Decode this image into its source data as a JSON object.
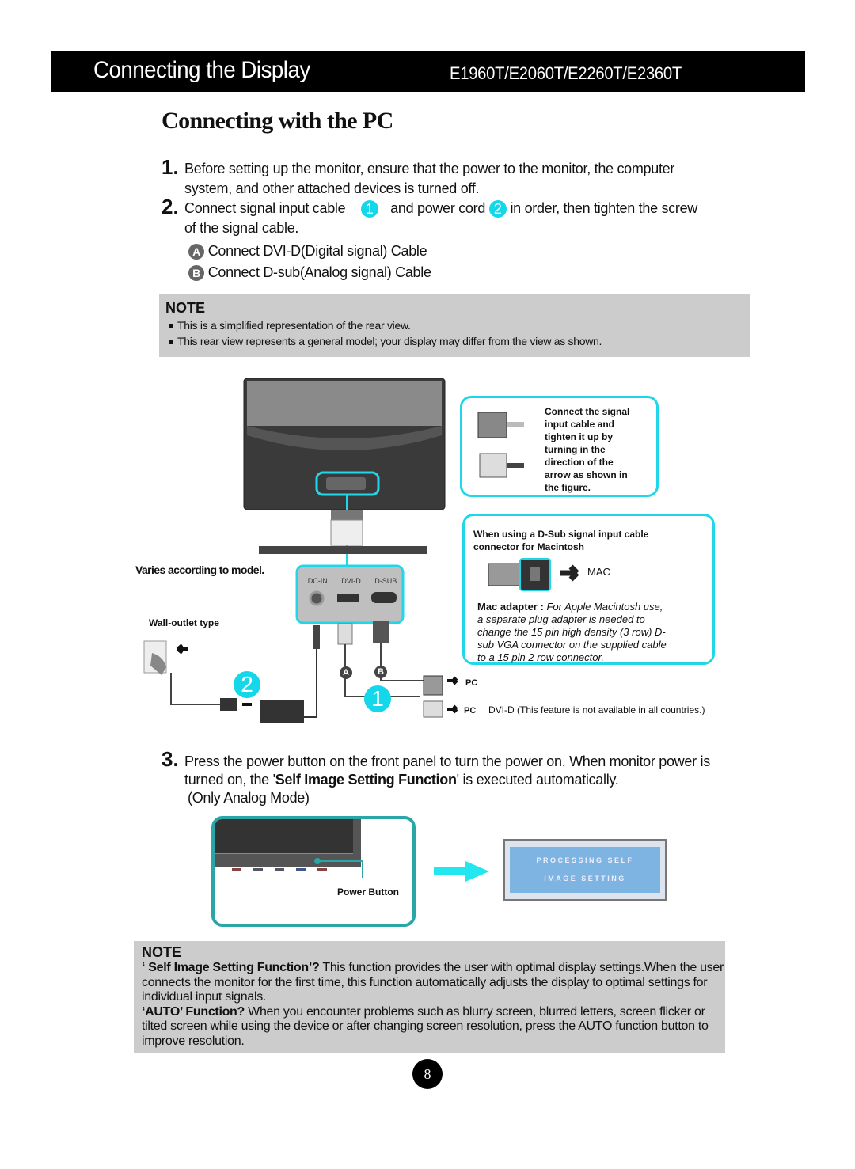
{
  "header": {
    "title": "Connecting the Display",
    "models": "E1960T/E2060T/E2260T/E2360T"
  },
  "section_title": "Connecting with the PC",
  "steps": {
    "s1": {
      "num": "1.",
      "line1": "Before setting up the monitor, ensure that the power to the monitor, the computer",
      "line2": "system, and other attached devices is turned off."
    },
    "s2": {
      "num": "2.",
      "part1": "Connect signal input cable",
      "badge1": "1",
      "part2": "and power cord",
      "badge2": "2",
      "part3": "in order, then tighten the screw",
      "line2": "of the signal cable."
    },
    "sub_a": {
      "badge": "A",
      "text": "Connect DVI-D(Digital signal) Cable"
    },
    "sub_b": {
      "badge": "B",
      "text": "Connect D-sub(Analog signal) Cable"
    },
    "s3": {
      "num": "3.",
      "line1": "Press the power button on the front panel to turn the power on. When monitor power is",
      "line2_pre": "turned on, the '",
      "line2_bold": "Self Image Setting Function",
      "line2_post": "' is executed automatically.",
      "line3": "(Only Analog Mode)"
    }
  },
  "note1": {
    "heading": "NOTE",
    "items": [
      "This is a simplified representation of the rear view.",
      "This rear view represents a general model; your display may differ from the view as shown."
    ]
  },
  "diagram": {
    "tighten_callout": "Connect the signal input cable and tighten it up by turning in the direction of the arrow as shown in the figure.",
    "tighten_lines": [
      "Connect the signal",
      "input cable and",
      "tighten it up by",
      "turning in the",
      "direction of the",
      "arrow as shown in",
      "the figure."
    ],
    "mac_heading": [
      "When using a D-Sub signal input cable",
      "connector for Macintosh"
    ],
    "mac_label": "MAC",
    "mac_adapter_bold": "Mac adapter :",
    "mac_adapter_lines": [
      "For Apple Macintosh use,",
      "a  separate plug adapter is needed to",
      "change the 15 pin high density (3 row) D-",
      "sub VGA connector on the supplied cable",
      "to a 15 pin  2 row connector."
    ],
    "varies": "Varies according to model.",
    "wall_outlet": "Wall-outlet type",
    "ports": [
      "DC-IN",
      "DVI-D",
      "D-SUB"
    ],
    "badge_a": "A",
    "badge_b": "B",
    "badge_1": "1",
    "badge_2": "2",
    "pc_label_1": "PC",
    "pc_label_2": "PC",
    "dvi_note": "DVI-D (This feature is not available in all countries.)",
    "power_button": "Power Button",
    "osd_line1": "PROCESSING SELF",
    "osd_line2": "IMAGE SETTING"
  },
  "note2": {
    "heading": "NOTE",
    "p1_bold": "‘ Self Image Setting Function’?",
    "p1_text": " This function provides the user with optimal display settings.When the user connects the monitor for the first time, this function automatically adjusts the display to optimal settings for individual input signals.",
    "p2_bold": "‘AUTO’ Function?",
    "p2_text": " When you encounter problems such as blurry screen, blurred letters, screen flicker or tilted screen while using the device or after changing screen resolution, press the AUTO function button to improve resolution."
  },
  "page_number": "8",
  "colors": {
    "accent_cyan": "#22d6ea",
    "note_bg": "#cccccc",
    "osd_blue": "#7eb4e2"
  }
}
